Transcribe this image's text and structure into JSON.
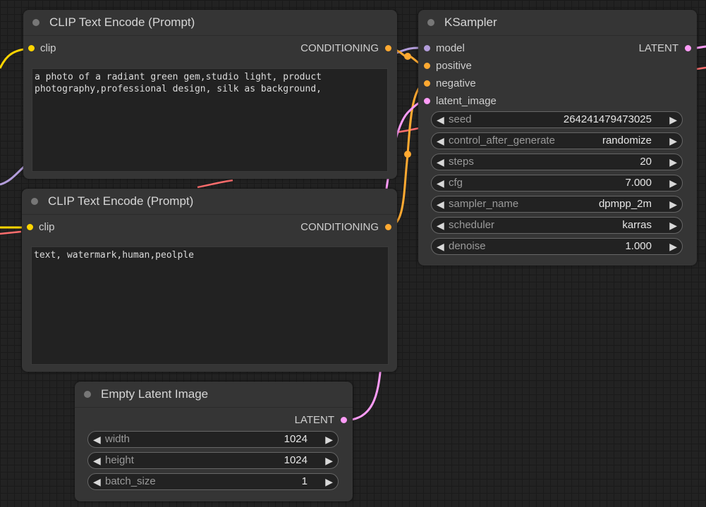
{
  "colors": {
    "clip": "#ffd500",
    "conditioning": "#ffa931",
    "latent": "#ff9cf9",
    "model": "#b39ddb",
    "vae_red": "#ff6e6e"
  },
  "clip_encode_positive": {
    "title": "CLIP Text Encode (Prompt)",
    "input_clip": "clip",
    "output": "CONDITIONING",
    "text": "a photo of a radiant green gem,studio light, product\nphotography,professional design, silk as background,"
  },
  "clip_encode_negative": {
    "title": "CLIP Text Encode (Prompt)",
    "input_clip": "clip",
    "output": "CONDITIONING",
    "text": "text, watermark,human,peolple"
  },
  "ksampler": {
    "title": "KSampler",
    "inputs": [
      "model",
      "positive",
      "negative",
      "latent_image"
    ],
    "output": "LATENT",
    "widgets": [
      {
        "name": "seed",
        "value": "264241479473025"
      },
      {
        "name": "control_after_generate",
        "value": "randomize"
      },
      {
        "name": "steps",
        "value": "20"
      },
      {
        "name": "cfg",
        "value": "7.000"
      },
      {
        "name": "sampler_name",
        "value": "dpmpp_2m"
      },
      {
        "name": "scheduler",
        "value": "karras"
      },
      {
        "name": "denoise",
        "value": "1.000"
      }
    ]
  },
  "empty_latent": {
    "title": "Empty Latent Image",
    "output": "LATENT",
    "widgets": [
      {
        "name": "width",
        "value": "1024"
      },
      {
        "name": "height",
        "value": "1024"
      },
      {
        "name": "batch_size",
        "value": "1"
      }
    ]
  }
}
